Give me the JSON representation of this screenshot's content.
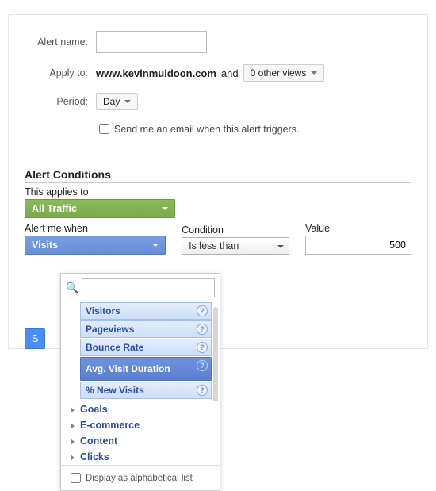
{
  "form": {
    "alertName": {
      "label": "Alert name:",
      "value": ""
    },
    "applyTo": {
      "label": "Apply to:",
      "domain": "www.kevinmuldoon.com",
      "and": "and",
      "otherViews": "0 other views"
    },
    "period": {
      "label": "Period:",
      "value": "Day"
    },
    "sendEmail": "Send me an email when this alert triggers.",
    "saveFragment": "S"
  },
  "conditions": {
    "heading": "Alert Conditions",
    "appliesToLabel": "This applies to",
    "appliesToValue": "All Traffic",
    "alertMeWhenLabel": "Alert me when",
    "metricValue": "Visits",
    "conditionLabel": "Condition",
    "conditionValue": "Is less than",
    "valueLabel": "Value",
    "value": "500"
  },
  "dropdown": {
    "search": "",
    "items": [
      "Visitors",
      "Pageviews",
      "Bounce Rate",
      "Avg. Visit Duration",
      "% New Visits"
    ],
    "categories": [
      "Goals",
      "E-commerce",
      "Content",
      "Clicks"
    ],
    "alpha": "Display as alphabetical list"
  }
}
